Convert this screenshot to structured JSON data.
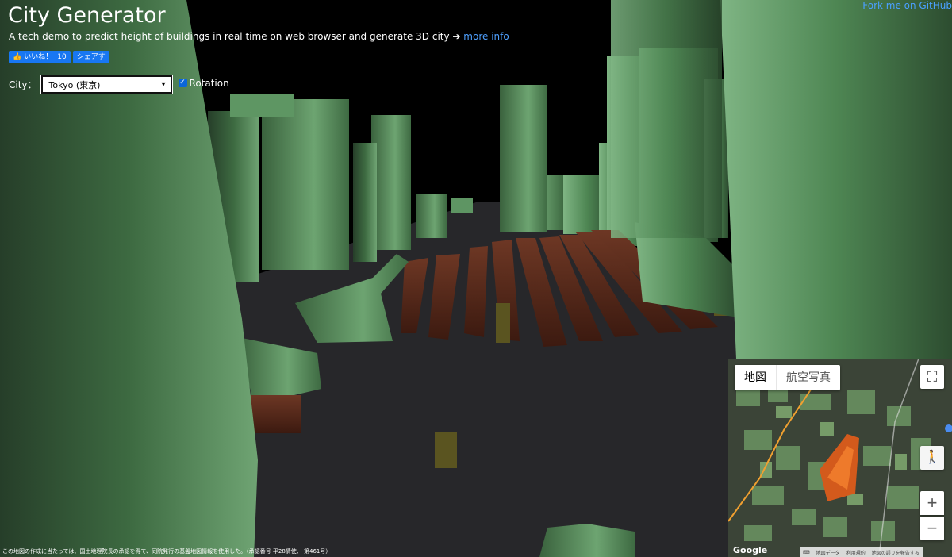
{
  "header": {
    "title": "City Generator",
    "subtitle": "A tech demo to predict height of buildings in real time on web browser and generate 3D city ➔",
    "more_info": "more info"
  },
  "social": {
    "like_label": "いいね！",
    "like_count": "10",
    "share_label": "シェアす"
  },
  "controls": {
    "city_label": "City：",
    "city_selected": "Tokyo (東京)",
    "rotation_label": "Rotation",
    "rotation_checked": true
  },
  "fork_label": "Fork me on GitHub",
  "credit_text": "この地図の作成に当たっては、国土地理院長の承認を得て、同院発行の基盤地図情報を使用した。（承認番号 平28情使、 第461号）",
  "map": {
    "tab_map": "地図",
    "tab_aerial": "航空写真",
    "zoom_in": "+",
    "zoom_out": "−",
    "google_logo": "Google",
    "footer_data": "地図データ",
    "footer_terms": "利用規約",
    "footer_report": "地図の誤りを報告する"
  },
  "colors": {
    "building_green": "#4f8553",
    "building_brown": "#5a2a1a",
    "link_blue": "#4ea0ff",
    "fb_blue": "#1877f2"
  }
}
